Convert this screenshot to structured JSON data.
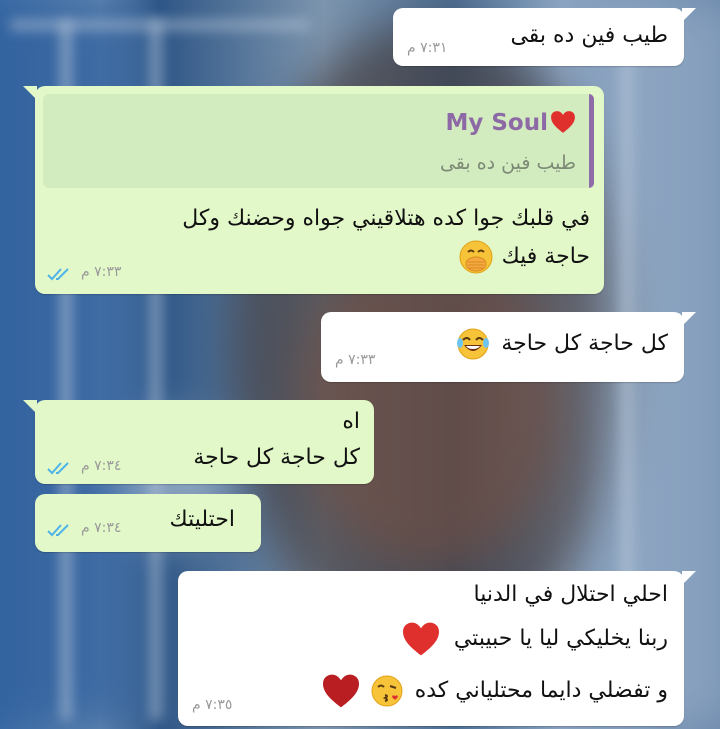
{
  "messages": [
    {
      "text": "طيب فين ده بقى",
      "time": "٧:٣١ م"
    },
    {
      "quote_name": "My Soul",
      "quote_text": "طيب فين ده بقى",
      "line1": "في قلبك جوا كده هتلاقيني جواه وحضنك وكل",
      "line2": "حاجة فيك",
      "time": "٧:٣٣ م"
    },
    {
      "text": "كل حاجة كل حاجة",
      "time": "٧:٣٣ م"
    },
    {
      "line1": "اه",
      "line2": "كل حاجة كل حاجة",
      "time": "٧:٣٤ م"
    },
    {
      "text": "احتليتك",
      "time": "٧:٣٤ م"
    },
    {
      "line1": "احلي احتلال في الدنيا",
      "line2": "ربنا يخليكي ليا يا حبيبتي",
      "line3": "و تفضلي دايما محتلياني كده",
      "time": "٧:٣٥ م"
    }
  ],
  "icons": {
    "read_ticks": "double-check-icon",
    "heart": "red-heart-icon",
    "emoji_hand_over_mouth": "face-with-hand-over-mouth-icon",
    "emoji_tears_of_joy": "face-with-tears-of-joy-icon",
    "emoji_blowing_kiss": "face-blowing-kiss-icon"
  },
  "colors": {
    "incoming_bubble": "#ffffff",
    "outgoing_bubble": "#e2f8c8",
    "read_ticks": "#4fb3e8",
    "quote_name": "#8d6aa6",
    "heart": "#e0302e"
  }
}
